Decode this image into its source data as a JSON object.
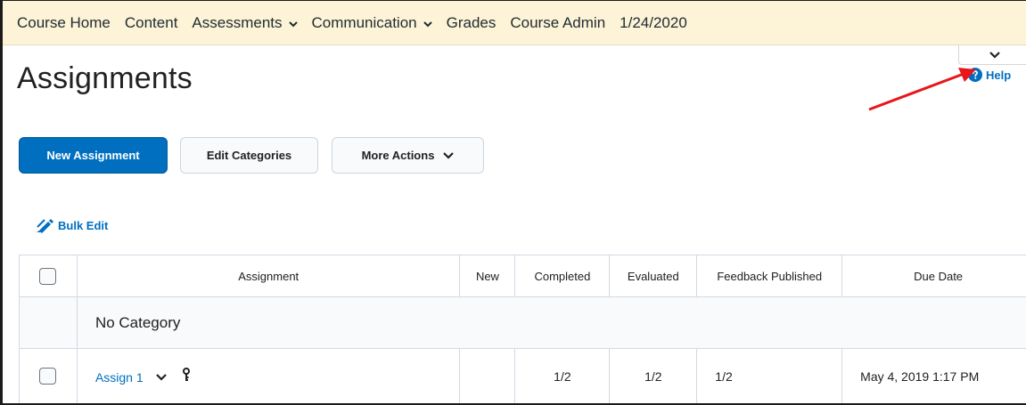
{
  "nav": {
    "items": [
      {
        "label": "Course Home",
        "dropdown": false
      },
      {
        "label": "Content",
        "dropdown": false
      },
      {
        "label": "Assessments",
        "dropdown": true
      },
      {
        "label": "Communication",
        "dropdown": true
      },
      {
        "label": "Grades",
        "dropdown": false
      },
      {
        "label": "Course Admin",
        "dropdown": false
      },
      {
        "label": "1/24/2020",
        "dropdown": false
      }
    ]
  },
  "help": {
    "label": "Help"
  },
  "page": {
    "title": "Assignments"
  },
  "actions": {
    "new_assignment": "New Assignment",
    "edit_categories": "Edit Categories",
    "more_actions": "More Actions"
  },
  "bulk_edit": {
    "label": "Bulk Edit"
  },
  "table": {
    "headers": [
      "Assignment",
      "New",
      "Completed",
      "Evaluated",
      "Feedback Published",
      "Due Date"
    ],
    "category": "No Category",
    "rows": [
      {
        "assignment": "Assign 1",
        "new": "",
        "completed": "1/2",
        "evaluated": "1/2",
        "feedback_published": "1/2",
        "due_date": "May 4, 2019 1:17 PM"
      }
    ]
  },
  "colors": {
    "navbar_bg": "#fdf3d6",
    "primary": "#006fbf",
    "annotation_arrow": "#e8161b"
  },
  "icons": [
    "chevron-down-icon",
    "help-circle-icon",
    "pencil-edit-icon",
    "key-icon"
  ]
}
